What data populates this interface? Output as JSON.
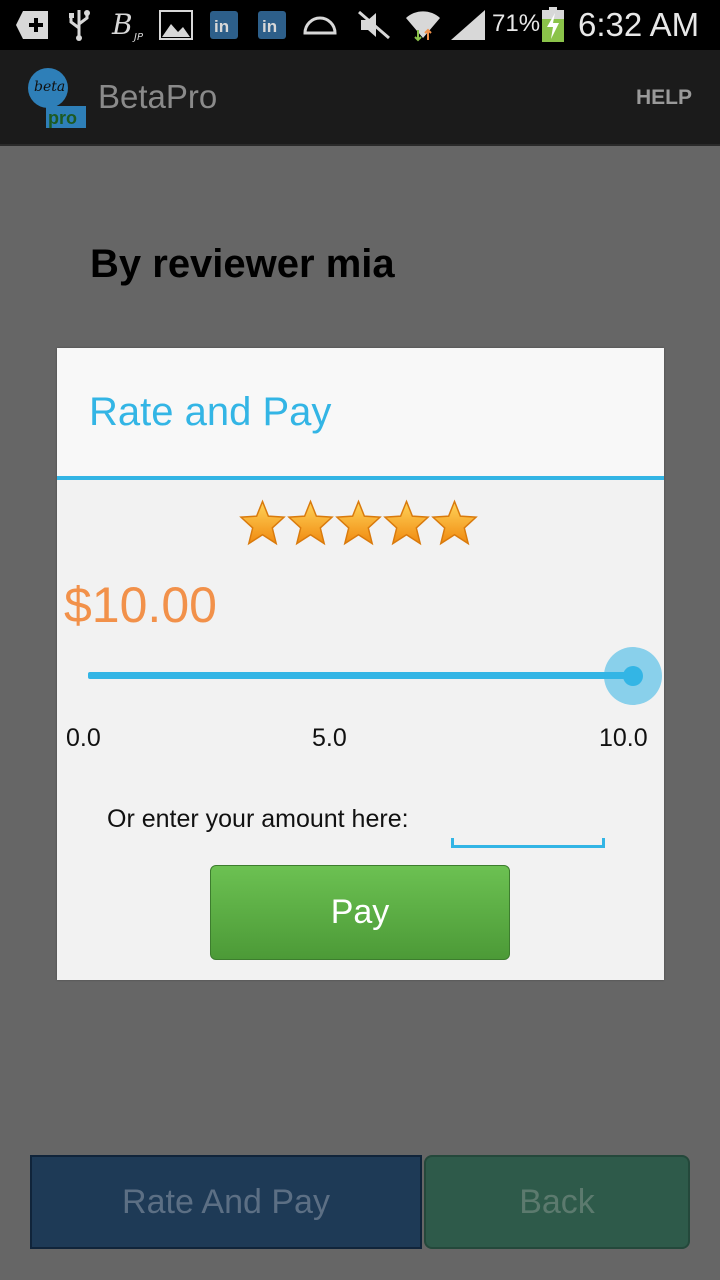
{
  "status_bar": {
    "battery_percent": "71%",
    "time": "6:32 AM",
    "icons": [
      "add-icon",
      "usb-icon",
      "bitcoin-icon",
      "image-icon",
      "linkedin-icon",
      "linkedin-icon",
      "dome-icon",
      "mute-icon",
      "wifi-icon",
      "signal-icon",
      "battery-charging-icon"
    ]
  },
  "action_bar": {
    "title": "BetaPro",
    "help_label": "HELP",
    "logo_text_top": "beta",
    "logo_text_bottom": "pro"
  },
  "page": {
    "heading": "By reviewer mia"
  },
  "dialog": {
    "title": "Rate and Pay",
    "rating": 5,
    "rating_max": 5,
    "amount": "$10.00",
    "slider": {
      "min_label": "0.0",
      "mid_label": "5.0",
      "max_label": "10.0",
      "value": 10.0,
      "min": 0.0,
      "max": 10.0
    },
    "enter_label": "Or enter your amount here:",
    "amount_input_value": "",
    "pay_label": "Pay"
  },
  "bottom_buttons": {
    "rate_and_pay_label": "Rate And Pay",
    "back_label": "Back"
  },
  "colors": {
    "accent": "#33b5e5",
    "amount": "#f2914a",
    "pay_button": "#5aad43",
    "star": "#f7a21b"
  }
}
